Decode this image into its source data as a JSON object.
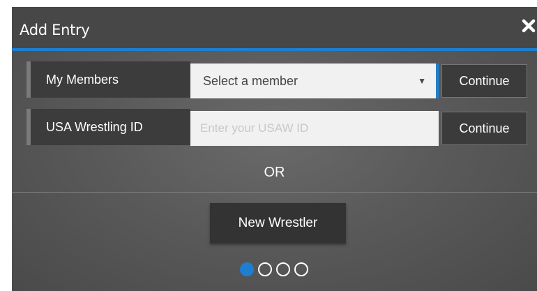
{
  "modal": {
    "title": "Add Entry",
    "close_icon": "close-icon",
    "accent_color": "#1e7fd1"
  },
  "rows": [
    {
      "label": "My Members",
      "select": {
        "selected": "Select a member",
        "caret_icon": "caret-down-icon"
      },
      "continue_label": "Continue"
    },
    {
      "label": "USA Wrestling ID",
      "input": {
        "value": "",
        "placeholder": "Enter your USAW ID"
      },
      "continue_label": "Continue"
    }
  ],
  "or_label": "OR",
  "new_wrestler_label": "New Wrestler",
  "steps": {
    "total": 4,
    "current": 1
  }
}
